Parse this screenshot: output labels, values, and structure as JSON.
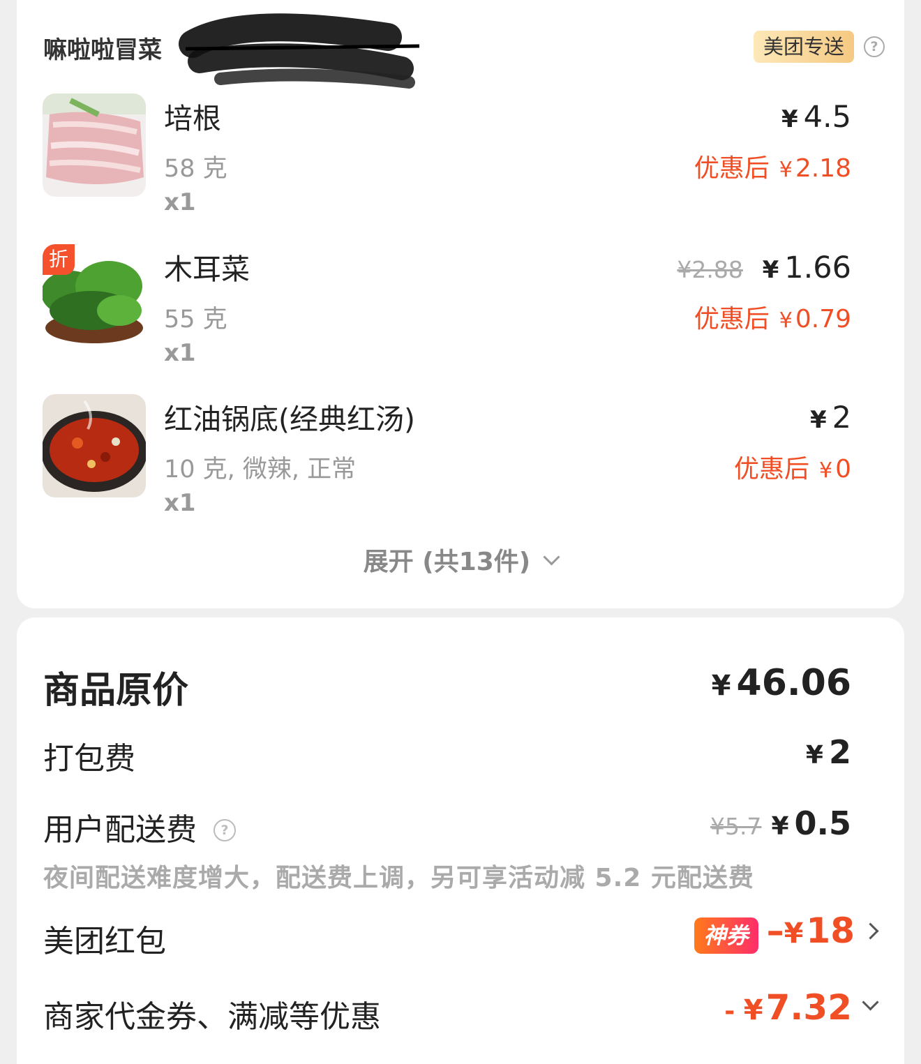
{
  "store": {
    "name": "嘛啦啦冒菜",
    "delivery_badge": "美团专送",
    "help_icon": "question-circle-icon"
  },
  "items": [
    {
      "name": "培根",
      "spec": "58 克",
      "qty": "x1",
      "original_price": "",
      "price_symbol": "¥",
      "price": "4.5",
      "discount_label": "优惠后",
      "discount_symbol": "¥",
      "discount_price": "2.18",
      "badge": ""
    },
    {
      "name": "木耳菜",
      "spec": "55 克",
      "qty": "x1",
      "original_price": "¥2.88",
      "price_symbol": "¥",
      "price": "1.66",
      "discount_label": "优惠后",
      "discount_symbol": "¥",
      "discount_price": "0.79",
      "badge": "折"
    },
    {
      "name": "红油锅底(经典红汤)",
      "spec": "10 克, 微辣, 正常",
      "qty": "x1",
      "original_price": "",
      "price_symbol": "¥",
      "price": "2",
      "discount_label": "优惠后",
      "discount_symbol": "¥",
      "discount_price": "0",
      "badge": ""
    }
  ],
  "expand": {
    "label": "展开 (共13件)"
  },
  "summary": {
    "original_total_label": "商品原价",
    "original_total_symbol": "¥",
    "original_total": "46.06",
    "packing_label": "打包费",
    "packing_symbol": "¥",
    "packing_fee": "2",
    "delivery_label": "用户配送费",
    "delivery_original": "¥5.7",
    "delivery_symbol": "¥",
    "delivery_fee": "0.5",
    "delivery_note": "夜间配送难度增大，配送费上调，另可享活动减 5.2 元配送费",
    "red_packet_label": "美团红包",
    "red_packet_badge": "神券",
    "red_packet_prefix": "–",
    "red_packet_symbol": "¥",
    "red_packet_value": "18",
    "merchant_label": "商家代金券、满减等优惠",
    "merchant_prefix": "- ",
    "merchant_symbol": "¥",
    "merchant_value": "7.32"
  },
  "colors": {
    "accent_red": "#f04e25",
    "badge_gold": "#f5c982",
    "muted": "#999999"
  }
}
